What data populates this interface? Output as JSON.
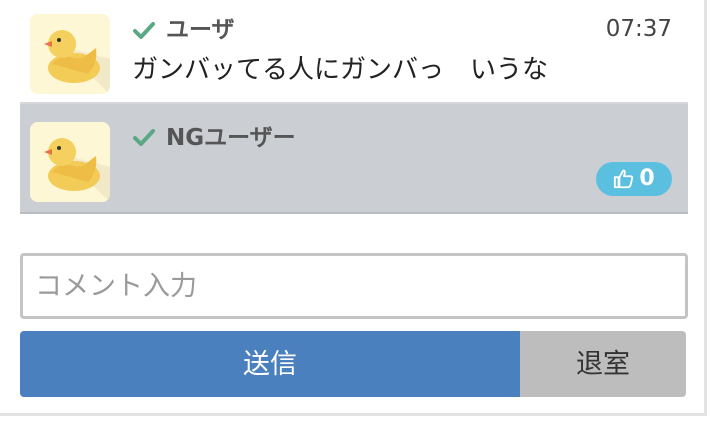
{
  "comments": [
    {
      "username": "ユーザ",
      "time": "07:37",
      "text": "ガンバッてる人にガンバっ　いうな",
      "avatar_icon": "duck-avatar-icon",
      "verified_icon": "checkmark-icon"
    },
    {
      "username": "NGユーザー",
      "like_count": "0",
      "avatar_icon": "duck-avatar-icon",
      "verified_icon": "checkmark-icon",
      "like_icon": "thumbs-up-icon"
    }
  ],
  "input": {
    "placeholder": "コメント入力",
    "value": ""
  },
  "buttons": {
    "send_label": "送信",
    "leave_label": "退室"
  },
  "colors": {
    "verified_check": "#5aa884",
    "highlight_row_bg": "#cbced3",
    "like_badge": "#5bbfe0",
    "send_button": "#4a80bd",
    "leave_button": "#bdbdbd",
    "avatar_bg": "#fdf7d6"
  }
}
